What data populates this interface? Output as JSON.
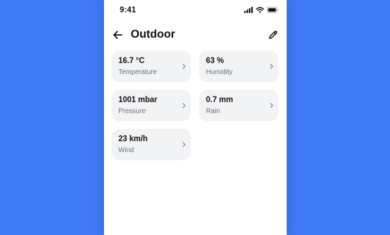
{
  "status_bar": {
    "time": "9:41",
    "icons": [
      "cellular-signal-icon",
      "wifi-icon",
      "battery-icon"
    ]
  },
  "header": {
    "back_icon": "arrow-left-icon",
    "title": "Outdoor",
    "edit_icon": "pencil-icon"
  },
  "cards": [
    {
      "value": "16.7 °C",
      "label": "Temperature",
      "icon": "chevron-right-icon"
    },
    {
      "value": "63 %",
      "label": "Humidity",
      "icon": "chevron-right-icon"
    },
    {
      "value": "1001 mbar",
      "label": "Pressure",
      "icon": "chevron-right-icon"
    },
    {
      "value": "0.7 mm",
      "label": "Rain",
      "icon": "chevron-right-icon"
    },
    {
      "value": "23 km/h",
      "label": "Wind",
      "icon": "chevron-right-icon"
    }
  ],
  "colors": {
    "background": "#4079f4",
    "card": "#f2f3f5",
    "text": "#111111",
    "muted": "#6b6f78"
  }
}
